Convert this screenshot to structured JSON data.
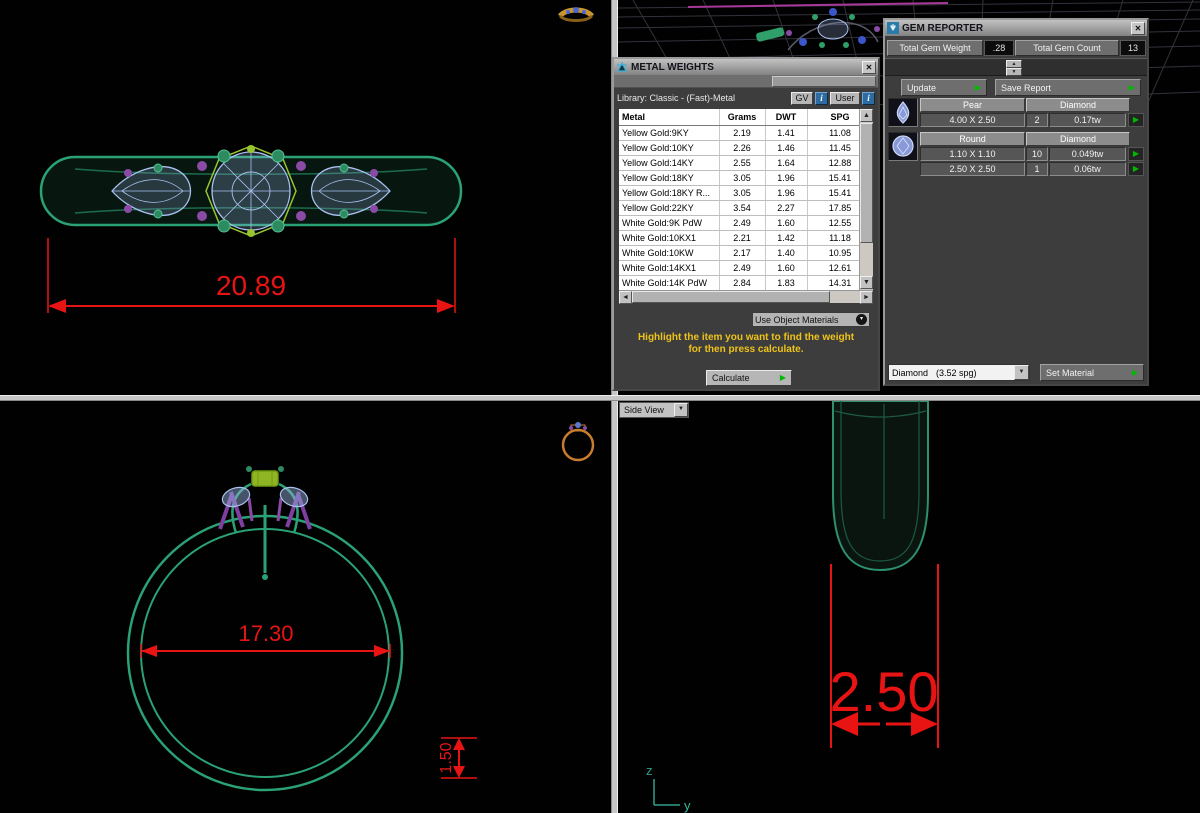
{
  "icons": {
    "close": "✕",
    "play": "▶",
    "up": "▲",
    "down": "▼",
    "left": "◄",
    "right": "►",
    "dropdown": "▼",
    "dot_dropdown": "▾"
  },
  "viewports": {
    "top": {
      "dimension": "20.89"
    },
    "front": {
      "dimension_diameter": "17.30",
      "dimension_thickness": "1.50"
    },
    "side": {
      "selector": "Side View",
      "dimension": "2.50",
      "axis_z": "z",
      "axis_y": "y"
    }
  },
  "metal_weights": {
    "title": "METAL WEIGHTS",
    "library": "Library: Classic - (Fast)-Metal",
    "gv": "GV",
    "gv_info": "i",
    "user": "User",
    "user_info": "i",
    "columns": [
      "Metal",
      "Grams",
      "DWT",
      "SPG"
    ],
    "rows": [
      [
        "Yellow Gold:9KY",
        "2.19",
        "1.41",
        "11.08"
      ],
      [
        "Yellow Gold:10KY",
        "2.26",
        "1.46",
        "11.45"
      ],
      [
        "Yellow Gold:14KY",
        "2.55",
        "1.64",
        "12.88"
      ],
      [
        "Yellow Gold:18KY",
        "3.05",
        "1.96",
        "15.41"
      ],
      [
        "Yellow Gold:18KY R...",
        "3.05",
        "1.96",
        "15.41"
      ],
      [
        "Yellow Gold:22KY",
        "3.54",
        "2.27",
        "17.85"
      ],
      [
        "White Gold:9K PdW",
        "2.49",
        "1.60",
        "12.55"
      ],
      [
        "White Gold:10KX1",
        "2.21",
        "1.42",
        "11.18"
      ],
      [
        "White Gold:10KW",
        "2.17",
        "1.40",
        "10.95"
      ],
      [
        "White Gold:14KX1",
        "2.49",
        "1.60",
        "12.61"
      ],
      [
        "White Gold:14K PdW",
        "2.84",
        "1.83",
        "14.31"
      ]
    ],
    "materials_dropdown": "Use Object Materials",
    "hint_line1": "Highlight the item you want to find the weight",
    "hint_line2": "for then press calculate.",
    "calculate": "Calculate"
  },
  "gem_reporter": {
    "title": "GEM REPORTER",
    "weight_label": "Total Gem Weight",
    "weight_value": ".28",
    "count_label": "Total Gem Count",
    "count_value": "13",
    "update": "Update",
    "save_report": "Save Report",
    "groups": [
      {
        "shape": "Pear",
        "material": "Diamond",
        "rows": [
          {
            "size": "4.00 X 2.50",
            "count": "2",
            "weight": "0.17tw"
          }
        ]
      },
      {
        "shape": "Round",
        "material": "Diamond",
        "rows": [
          {
            "size": "1.10 X 1.10",
            "count": "10",
            "weight": "0.049tw"
          },
          {
            "size": "2.50 X 2.50",
            "count": "1",
            "weight": "0.06tw"
          }
        ]
      }
    ],
    "material_name": "Diamond",
    "material_spg": "(3.52 spg)",
    "set_material": "Set Material"
  }
}
